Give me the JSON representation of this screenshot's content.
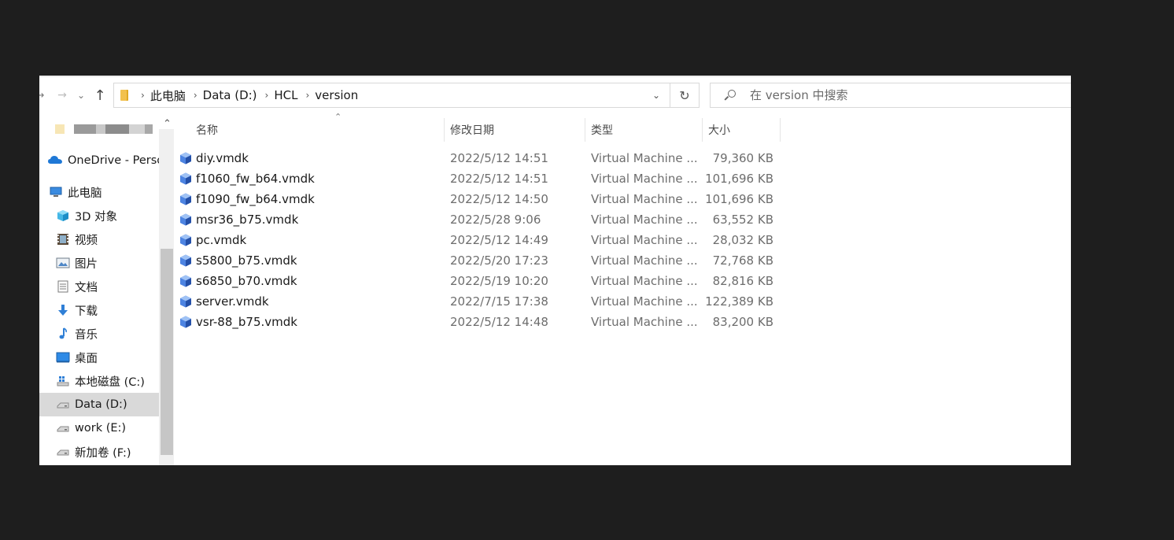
{
  "colors": {
    "background": "#1e1e1e",
    "window": "#ffffff",
    "selected": "#d9d9d9",
    "accent_blue": "#2d6fd8",
    "folder_yellow": "#f2c14e"
  },
  "nav": {
    "back_icon": "back-arrow-icon",
    "forward_icon": "forward-arrow-icon",
    "recent_icon": "chevron-down-icon",
    "up_icon": "up-arrow-icon"
  },
  "address": {
    "breadcrumbs": [
      "此电脑",
      "Data (D:)",
      "HCL",
      "version"
    ]
  },
  "search": {
    "placeholder": "在 version 中搜索"
  },
  "sidebar": {
    "items": [
      {
        "label": "OneDrive - Perso",
        "icon": "onedrive-cloud-icon"
      },
      {
        "label": "此电脑",
        "icon": "this-pc-icon"
      },
      {
        "label": "3D 对象",
        "icon": "3d-objects-icon"
      },
      {
        "label": "视频",
        "icon": "videos-icon"
      },
      {
        "label": "图片",
        "icon": "pictures-icon"
      },
      {
        "label": "文档",
        "icon": "documents-icon"
      },
      {
        "label": "下载",
        "icon": "downloads-icon"
      },
      {
        "label": "音乐",
        "icon": "music-icon"
      },
      {
        "label": "桌面",
        "icon": "desktop-icon"
      },
      {
        "label": "本地磁盘 (C:)",
        "icon": "system-drive-icon"
      },
      {
        "label": "Data (D:)",
        "icon": "drive-icon",
        "selected": true
      },
      {
        "label": "work (E:)",
        "icon": "drive-icon"
      },
      {
        "label": "新加卷 (F:)",
        "icon": "drive-icon"
      }
    ]
  },
  "columns": {
    "name": "名称",
    "date": "修改日期",
    "type": "类型",
    "size": "大小"
  },
  "files": [
    {
      "name": "diy.vmdk",
      "date": "2022/5/12 14:51",
      "type": "Virtual Machine ...",
      "size": "79,360 KB"
    },
    {
      "name": "f1060_fw_b64.vmdk",
      "date": "2022/5/12 14:51",
      "type": "Virtual Machine ...",
      "size": "101,696 KB"
    },
    {
      "name": "f1090_fw_b64.vmdk",
      "date": "2022/5/12 14:50",
      "type": "Virtual Machine ...",
      "size": "101,696 KB"
    },
    {
      "name": "msr36_b75.vmdk",
      "date": "2022/5/28 9:06",
      "type": "Virtual Machine ...",
      "size": "63,552 KB"
    },
    {
      "name": "pc.vmdk",
      "date": "2022/5/12 14:49",
      "type": "Virtual Machine ...",
      "size": "28,032 KB"
    },
    {
      "name": "s5800_b75.vmdk",
      "date": "2022/5/20 17:23",
      "type": "Virtual Machine ...",
      "size": "72,768 KB"
    },
    {
      "name": "s6850_b70.vmdk",
      "date": "2022/5/19 10:20",
      "type": "Virtual Machine ...",
      "size": "82,816 KB"
    },
    {
      "name": "server.vmdk",
      "date": "2022/7/15 17:38",
      "type": "Virtual Machine ...",
      "size": "122,389 KB"
    },
    {
      "name": "vsr-88_b75.vmdk",
      "date": "2022/5/12 14:48",
      "type": "Virtual Machine ...",
      "size": "83,200 KB"
    }
  ]
}
